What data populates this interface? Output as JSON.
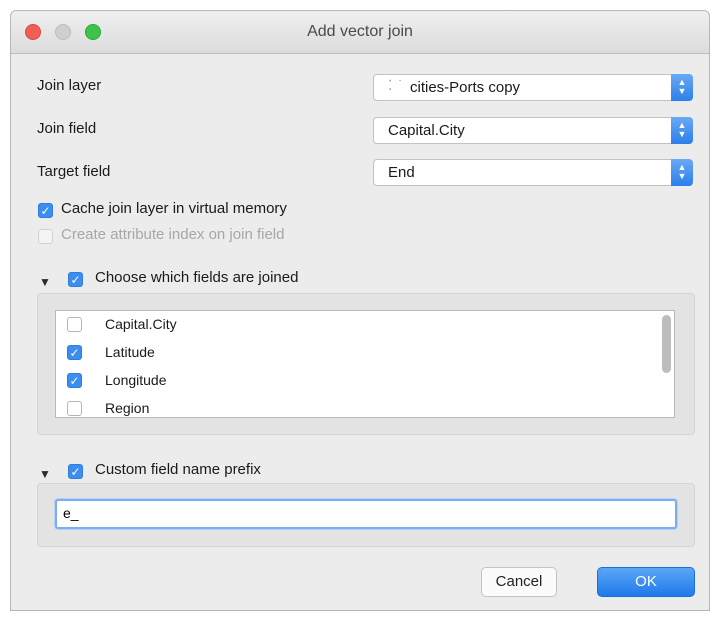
{
  "window": {
    "title": "Add vector join"
  },
  "form": {
    "join_layer": {
      "label": "Join layer",
      "value": "cities-Ports copy",
      "icon": "vector-layer-icon"
    },
    "join_field": {
      "label": "Join field",
      "value": "Capital.City"
    },
    "target_field": {
      "label": "Target field",
      "value": "End"
    },
    "cache": {
      "label": "Cache join layer in virtual memory",
      "checked": true
    },
    "index": {
      "label": "Create attribute index on join field",
      "checked": false,
      "disabled": true
    }
  },
  "fields_group": {
    "label": "Choose which fields are joined",
    "checked": true,
    "items": [
      {
        "label": "Capital.City",
        "checked": false
      },
      {
        "label": "Latitude",
        "checked": true
      },
      {
        "label": "Longitude",
        "checked": true
      },
      {
        "label": "Region",
        "checked": false
      }
    ]
  },
  "prefix_group": {
    "label": "Custom field name prefix",
    "checked": true,
    "value": "e_"
  },
  "buttons": {
    "cancel": "Cancel",
    "ok": "OK"
  },
  "colors": {
    "accent": "#3b8ef0",
    "close": "#f25e56",
    "zoom": "#3bc447"
  }
}
